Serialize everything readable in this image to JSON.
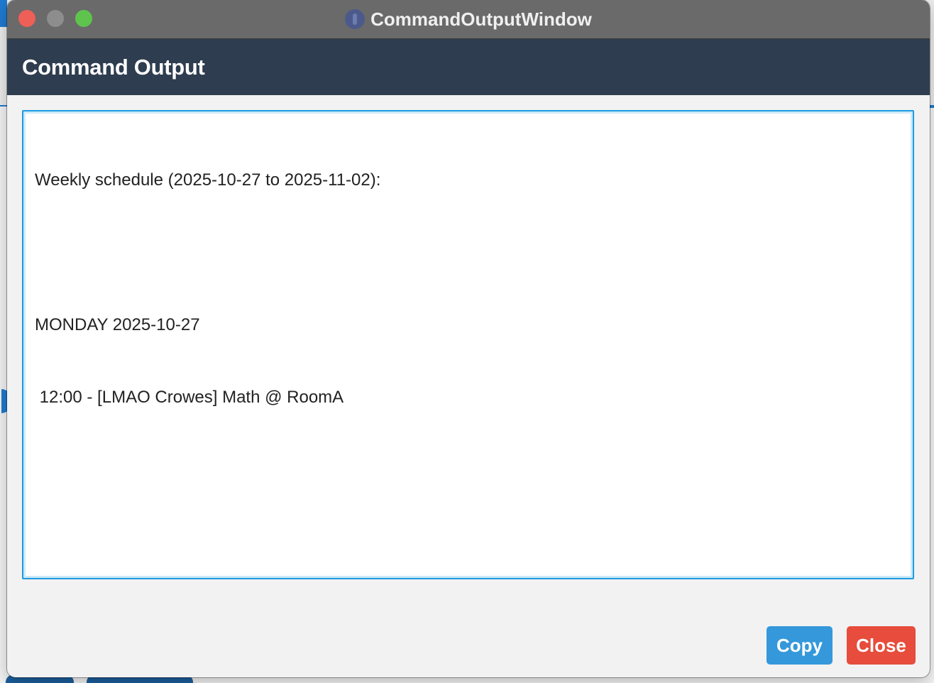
{
  "window": {
    "title": "CommandOutputWindow"
  },
  "header": {
    "title": "Command Output"
  },
  "output": {
    "lines": [
      "Weekly schedule (2025-10-27 to 2025-11-02):",
      "",
      "MONDAY 2025-10-27",
      " 12:00 - [LMAO Crowes] Math @ RoomA"
    ]
  },
  "buttons": {
    "copy_label": "Copy",
    "close_label": "Close"
  },
  "colors": {
    "header_bg": "#2e3d4f",
    "copy_button": "#3498db",
    "close_button": "#e74c3c",
    "focus_border": "#1e9ae0"
  },
  "icons": {
    "app": "info-icon"
  }
}
